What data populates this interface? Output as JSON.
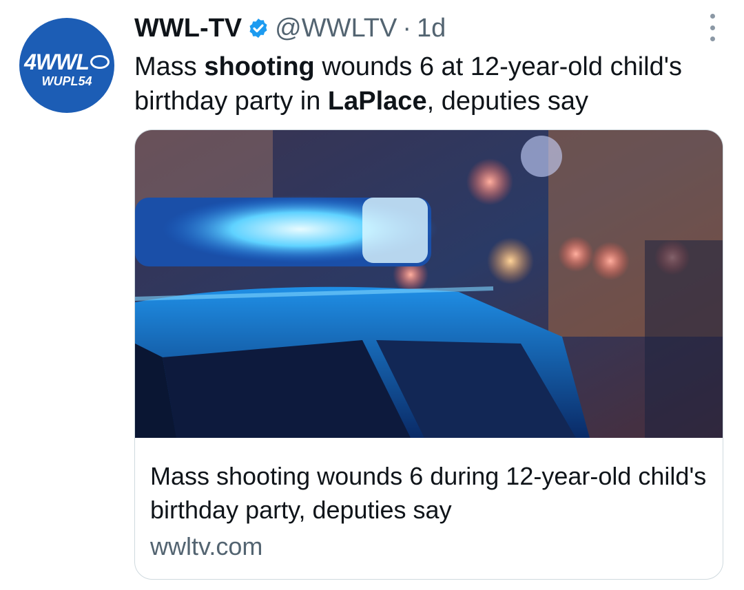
{
  "author": {
    "name": "WWL-TV",
    "handle": "@WWLTV",
    "separator": "·",
    "timestamp": "1d",
    "avatar_text_main": "4WWL",
    "avatar_text_sub": "WUPL54"
  },
  "tweet": {
    "part1": "Mass ",
    "bold1": "shooting",
    "part2": " wounds 6 at 12-year-old child's birthday party in ",
    "bold2": "LaPlace",
    "part3": ", deputies say"
  },
  "card": {
    "title": "Mass shooting wounds 6 during 12-year-old child's birthday party, deputies say",
    "domain": "wwltv.com"
  },
  "colors": {
    "brand_blue": "#1c5db5",
    "verified_blue": "#1d9bf0",
    "muted_gray": "#536471",
    "text_dark": "#0f1419"
  },
  "icons": [
    "verified-badge-icon",
    "more-options-icon"
  ]
}
